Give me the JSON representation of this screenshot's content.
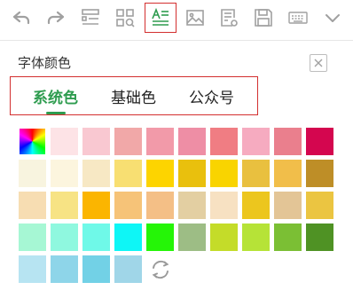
{
  "toolbar": {
    "buttons": [
      {
        "name": "undo-icon"
      },
      {
        "name": "redo-icon"
      },
      {
        "name": "layout-list-icon"
      },
      {
        "name": "grid-search-icon"
      },
      {
        "name": "text-color-icon",
        "active": true
      },
      {
        "name": "image-icon"
      },
      {
        "name": "document-settings-icon"
      },
      {
        "name": "save-icon"
      },
      {
        "name": "keyboard-icon"
      },
      {
        "name": "chevron-down-icon"
      }
    ],
    "active_border_color": "#d32f2f",
    "icon_color": "#a0a0a0",
    "active_icon_color": "#2e9c4f"
  },
  "panel": {
    "title": "字体颜色",
    "close_icon": "close-icon"
  },
  "tabs": [
    {
      "label": "系统色",
      "active": true
    },
    {
      "label": "基础色",
      "active": false
    },
    {
      "label": "公众号",
      "active": false
    }
  ],
  "accent_color": "#2e9c4f",
  "palette": [
    [
      "rainbow",
      "#fde3e6",
      "#f9c8d1",
      "#f1a8a8",
      "#f29aa9",
      "#ee8ea5",
      "#f07d83",
      "#f6abc0",
      "#ea7f8d",
      "#d4064f"
    ],
    [
      "#f8f4df",
      "#fcf5de",
      "#f7e8c4",
      "#f8df72",
      "#fdd400",
      "#e9c00d",
      "#f9d400",
      "#e9c03f",
      "#f1be4a",
      "#be8e27"
    ],
    [
      "#f7ddb2",
      "#f7e384",
      "#fbb500",
      "#f6c378",
      "#f4bf86",
      "#e3cfa2",
      "#f7e1c2",
      "#ecc61e",
      "#e3c596",
      "#ebc541"
    ],
    [
      "#a6f7d4",
      "#8ff8df",
      "#6ff9e8",
      "#0ef6f6",
      "#25f507",
      "#9dbd85",
      "#c4dc29",
      "#b6e337",
      "#7bbf34",
      "#4f9224"
    ],
    [
      "#b7e4f2",
      "#8ed5e9",
      "#72d1e6",
      "#a0d6e8"
    ]
  ],
  "refresh_icon": "refresh-icon"
}
